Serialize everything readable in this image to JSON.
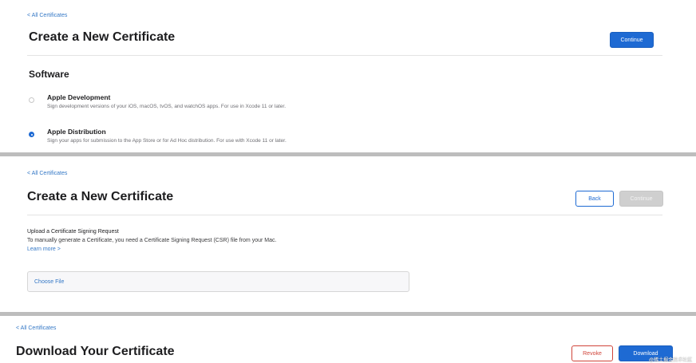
{
  "panel1": {
    "breadcrumb": "< All Certificates",
    "title": "Create a New Certificate",
    "continue_label": "Continue",
    "section_title": "Software",
    "options": [
      {
        "title": "Apple Development",
        "description": "Sign development versions of your iOS, macOS, tvOS, and watchOS apps. For use in Xcode 11 or later.",
        "selected": false
      },
      {
        "title": "Apple Distribution",
        "description": "Sign your apps for submission to the App Store or for Ad Hoc distribution. For use with Xcode 11 or later.",
        "selected": true
      }
    ]
  },
  "panel2": {
    "breadcrumb": "< All Certificates",
    "title": "Create a New Certificate",
    "back_label": "Back",
    "continue_label": "Continue",
    "upload_title": "Upload a Certificate Signing Request",
    "upload_desc": "To manually generate a Certificate, you need a Certificate Signing Request (CSR) file from your Mac.",
    "learn_more": "Learn more >",
    "choose_file": "Choose File"
  },
  "panel3": {
    "breadcrumb": "< All Certificates",
    "title": "Download Your Certificate",
    "revoke_label": "Revoke",
    "download_label": "Download"
  },
  "watermark": "@稀土掘金技术社区",
  "colors": {
    "accent": "#1e6ad3",
    "danger": "#d0453a",
    "link": "#3478c6",
    "separator": "#bdbdbd"
  }
}
